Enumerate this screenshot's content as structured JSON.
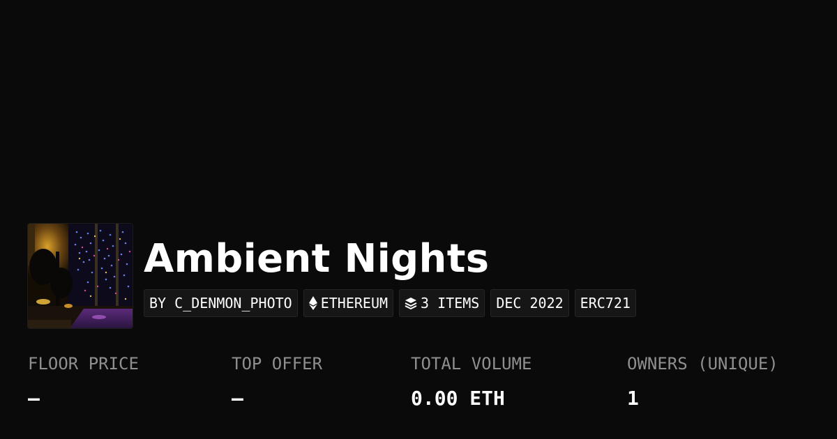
{
  "collection": {
    "title": "Ambient Nights",
    "thumbnail": "night-city-lights-photo"
  },
  "tags": {
    "creator": "BY C_DENMON_PHOTO",
    "chain": "ETHEREUM",
    "chain_icon": "ethereum-icon",
    "items": "3 ITEMS",
    "items_icon": "layers-icon",
    "date": "DEC 2022",
    "standard": "ERC721"
  },
  "stats": {
    "floor_price": {
      "label": "FLOOR PRICE",
      "value": "–"
    },
    "top_offer": {
      "label": "TOP OFFER",
      "value": "–"
    },
    "total_volume": {
      "label": "TOTAL VOLUME",
      "value": "0.00 ETH"
    },
    "owners": {
      "label": "OWNERS (UNIQUE)",
      "value": "1"
    }
  },
  "colors": {
    "background": "#0a0a0a",
    "label": "#8f8f8f",
    "tag_background": "#161616",
    "text": "#ffffff"
  }
}
